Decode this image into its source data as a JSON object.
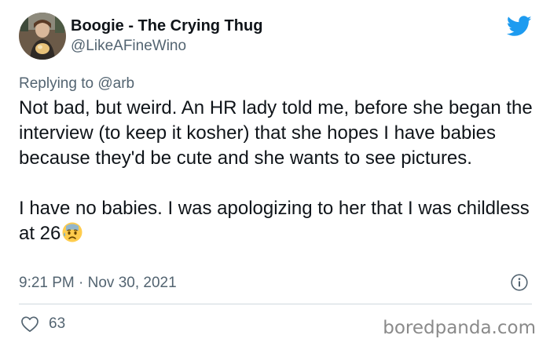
{
  "tweet": {
    "author": {
      "display_name": "Boogie - The Crying Thug",
      "handle": "@LikeAFineWino"
    },
    "reply_context": {
      "prefix": "Replying to",
      "mention": "@arb"
    },
    "text_paragraphs": [
      "Not bad, but weird. An HR lady told me, before she began the interview (to keep it kosher) that she hopes I have babies because they'd be cute and she wants to see pictures.",
      "I have no babies. I was apologizing to her that I was childless at 26"
    ],
    "trailing_emoji": "anxious-face-with-sweat-emoji",
    "timestamp": "9:21 PM · Nov 30, 2021",
    "like_count": "63"
  },
  "icons": {
    "brand": "twitter-bird-icon",
    "info": "info-icon",
    "like": "heart-icon"
  },
  "colors": {
    "twitter_blue": "#1d9bf0",
    "secondary_text": "#536471",
    "primary_text": "#0f1419",
    "divider": "#cfd9de"
  },
  "watermark": "boredpanda.com"
}
